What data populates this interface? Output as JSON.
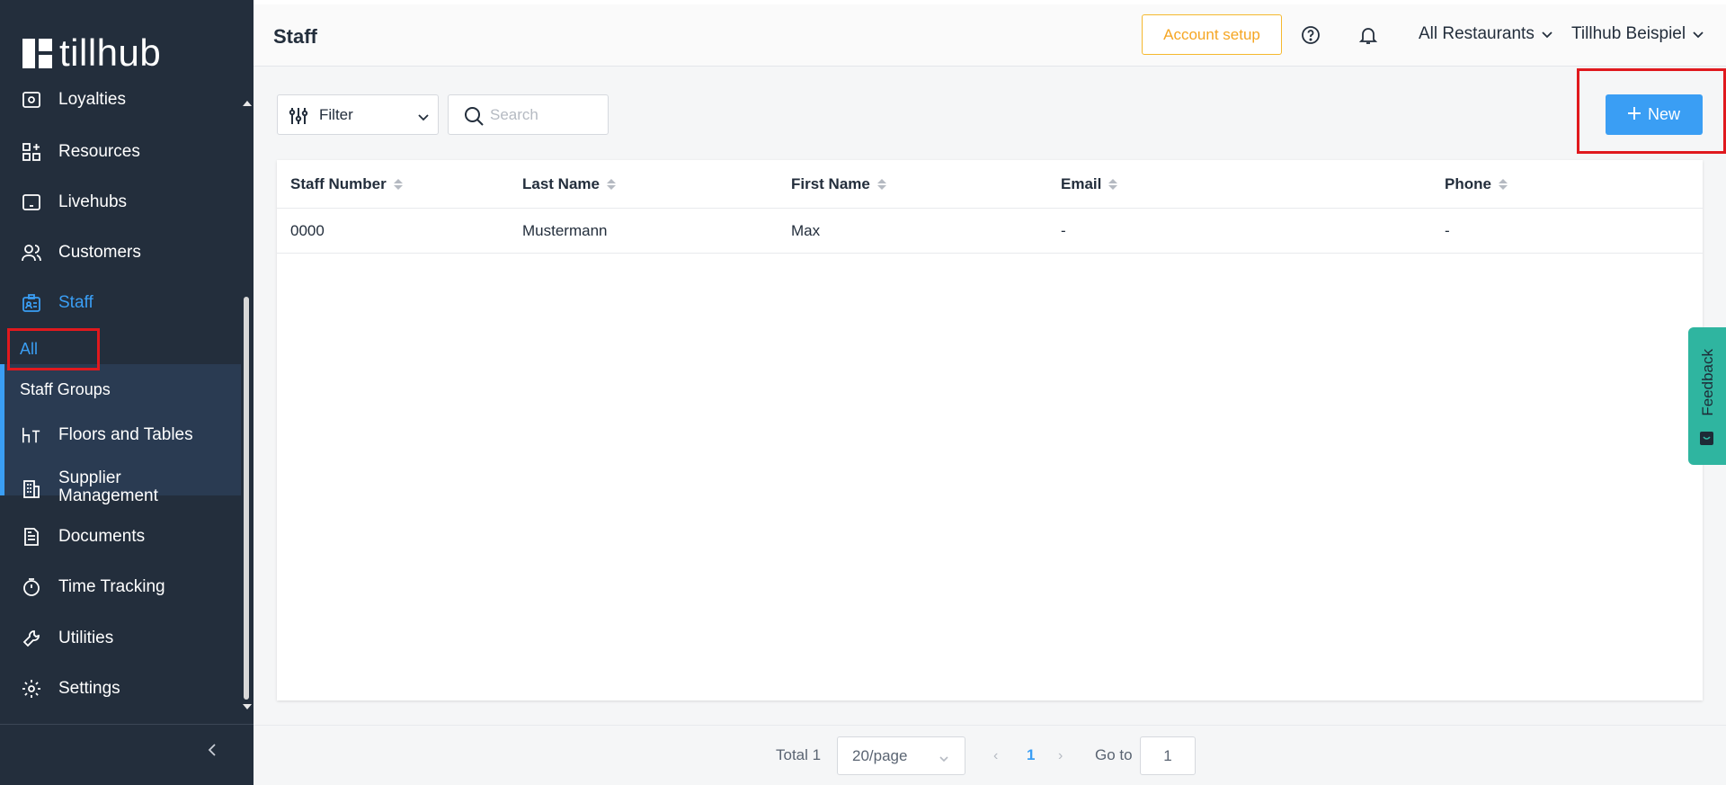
{
  "app": {
    "logo_text": "tillhub"
  },
  "sidebar": {
    "items": [
      {
        "label": "Loyalties",
        "icon": "loyalties-icon"
      },
      {
        "label": "Resources",
        "icon": "resources-icon"
      },
      {
        "label": "Livehubs",
        "icon": "tablet-icon"
      },
      {
        "label": "Customers",
        "icon": "users-icon"
      },
      {
        "label": "Staff",
        "icon": "staff-badge-icon",
        "active": true
      },
      {
        "label": "Floors and Tables",
        "icon": "floors-tables-icon"
      },
      {
        "label_line1": "Supplier",
        "label_line2": "Management",
        "icon": "building-icon"
      },
      {
        "label": "Documents",
        "icon": "document-icon"
      },
      {
        "label": "Time Tracking",
        "icon": "stopwatch-icon"
      },
      {
        "label": "Utilities",
        "icon": "wrench-icon"
      },
      {
        "label": "Settings",
        "icon": "gear-icon"
      }
    ],
    "staff_subitems": [
      {
        "label": "All",
        "active": true
      },
      {
        "label": "Staff Groups"
      }
    ]
  },
  "header": {
    "title": "Staff",
    "account_setup": "Account setup",
    "restaurants": "All Restaurants",
    "account": "Tillhub Beispiel"
  },
  "toolbar": {
    "filter_label": "Filter",
    "search_placeholder": "Search",
    "new_label": "New"
  },
  "table": {
    "columns": [
      "Staff Number",
      "Last Name",
      "First Name",
      "Email",
      "Phone"
    ],
    "rows": [
      [
        "0000",
        "Mustermann",
        "Max",
        "-",
        "-"
      ]
    ]
  },
  "feedback": {
    "label": "Feedback"
  },
  "pagination": {
    "total": "Total 1",
    "page_size": "20/page",
    "current_page": "1",
    "goto_label": "Go to",
    "goto_value": "1"
  },
  "colors": {
    "sidebar_bg": "#232e3c",
    "accent_blue": "#3a9ef4",
    "account_setup_orange": "#f5a623",
    "feedback_teal": "#2fb5a0",
    "highlight_red": "#e0191e"
  }
}
